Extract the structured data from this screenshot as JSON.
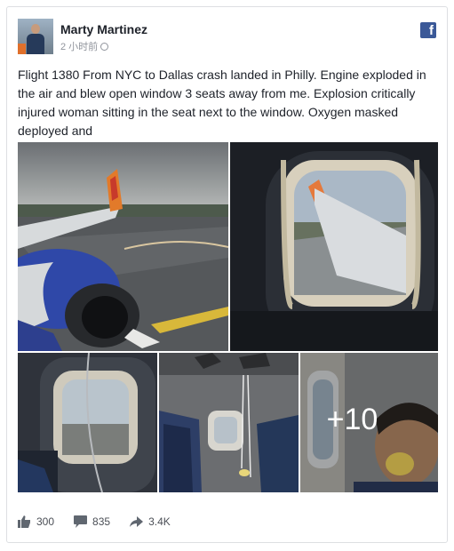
{
  "post": {
    "author": "Marty Martinez",
    "time": "2 小时前",
    "text": "Flight 1380 From NYC to Dallas crash landed in Philly. Engine exploded in the air and blew open window 3 seats away from me. Explosion critically injured woman sitting in the seat next to the window. Oxygen masked deployed and"
  },
  "photos": {
    "more_count": "+10"
  },
  "stats": {
    "likes": "300",
    "comments": "835",
    "shares": "3.4K"
  },
  "colors": {
    "facebook_blue": "#3b5998",
    "text": "#1d2129",
    "meta": "#90949c"
  },
  "icons": [
    "facebook-icon",
    "globe-icon",
    "like-icon",
    "comment-icon",
    "share-icon"
  ]
}
